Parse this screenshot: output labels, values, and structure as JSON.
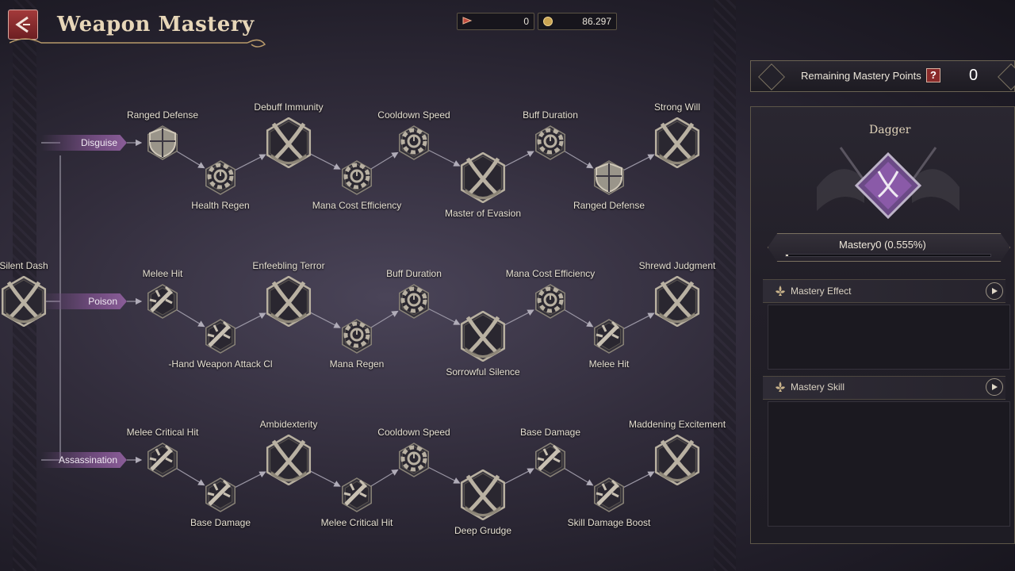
{
  "header": {
    "title": "Weapon Mastery"
  },
  "currencies": [
    {
      "name": "flag-token-icon",
      "value": "0"
    },
    {
      "name": "gold-coin-icon",
      "value": "86.297"
    }
  ],
  "colors": {
    "accent": "#8a5d98",
    "panel": "#26232c",
    "back_button": "#a33a3a"
  },
  "tree": {
    "root": {
      "label": "Silent Dash"
    },
    "branches": [
      {
        "label": "Disguise",
        "top": [
          "Ranged Defense",
          "Debuff Immunity",
          "Cooldown Speed",
          "Buff Duration",
          "Strong Will"
        ],
        "bottom": [
          "Health Regen",
          "Mana Cost Efficiency",
          "Master of Evasion",
          "Ranged Defense"
        ]
      },
      {
        "label": "Poison",
        "top": [
          "Melee Hit",
          "Enfeebling Terror",
          "Buff Duration",
          "Mana Cost Efficiency",
          "Shrewd Judgment"
        ],
        "bottom": [
          "-Hand Weapon Attack Cl",
          "Mana Regen",
          "Sorrowful Silence",
          "Melee Hit"
        ]
      },
      {
        "label": "Assassination",
        "top": [
          "Melee Critical Hit",
          "Ambidexterity",
          "Cooldown Speed",
          "Base Damage",
          "Maddening Excitement"
        ],
        "bottom": [
          "Base Damage",
          "Melee Critical Hit",
          "Deep Grudge",
          "Skill Damage Boost"
        ]
      }
    ]
  },
  "panel": {
    "remaining_label": "Remaining Mastery Points",
    "help": "?",
    "remaining_value": "0",
    "weapon": "Dagger",
    "mastery_text": "Mastery0  (0.555%)",
    "mastery_progress": 0.00555,
    "effect_title": "Mastery Effect",
    "skill_title": "Mastery Skill"
  }
}
